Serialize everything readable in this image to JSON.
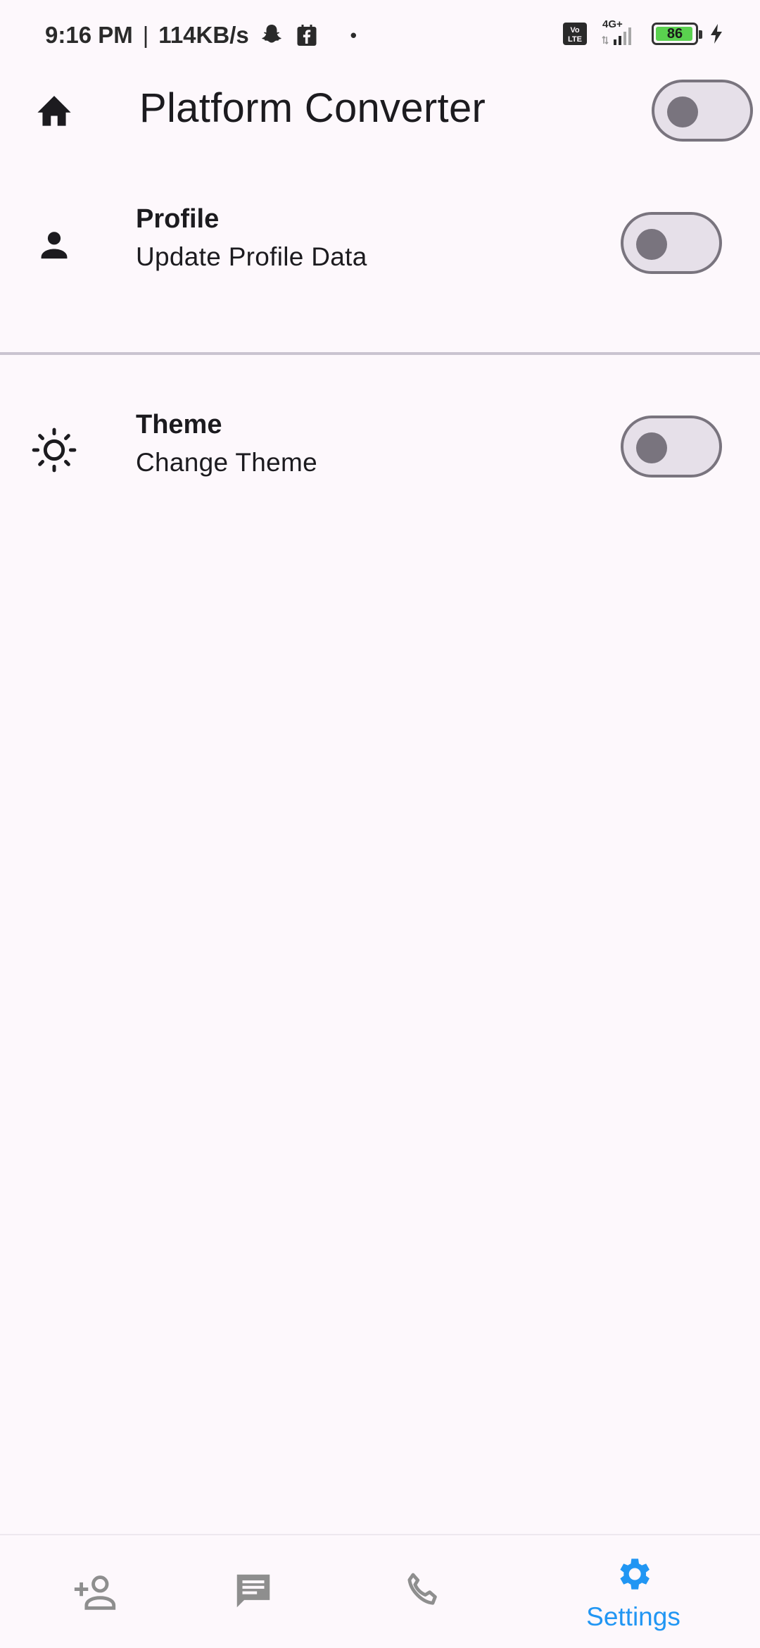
{
  "status_bar": {
    "time": "9:16 PM",
    "separator": "|",
    "network_speed": "114KB/s",
    "dot": "•",
    "network_type": "4G+",
    "volte": "Vo LTE",
    "battery_level": "86",
    "icons": [
      "snapchat-icon",
      "facebook-shop-icon",
      "volte-icon",
      "signal-icon",
      "battery-icon",
      "charging-icon"
    ]
  },
  "app_bar": {
    "title": "Platform Converter",
    "leading_icon": "home-icon",
    "toggle_on": false
  },
  "settings": [
    {
      "icon": "person-icon",
      "title": "Profile",
      "subtitle": "Update Profile Data",
      "toggle_on": false
    },
    {
      "icon": "sun-icon",
      "title": "Theme",
      "subtitle": "Change Theme",
      "toggle_on": false
    }
  ],
  "bottom_nav": {
    "items": [
      {
        "icon": "add-person-icon",
        "label": ""
      },
      {
        "icon": "chat-icon",
        "label": ""
      },
      {
        "icon": "phone-icon",
        "label": ""
      },
      {
        "icon": "settings-icon",
        "label": "Settings",
        "selected": true
      }
    ],
    "active_color": "#2196f3",
    "inactive_color": "#9e9e9e"
  },
  "colors": {
    "background": "#fdf8fc",
    "switch_track": "#e6e0e9",
    "switch_outline": "#79747e",
    "divider": "#cac4d0"
  }
}
